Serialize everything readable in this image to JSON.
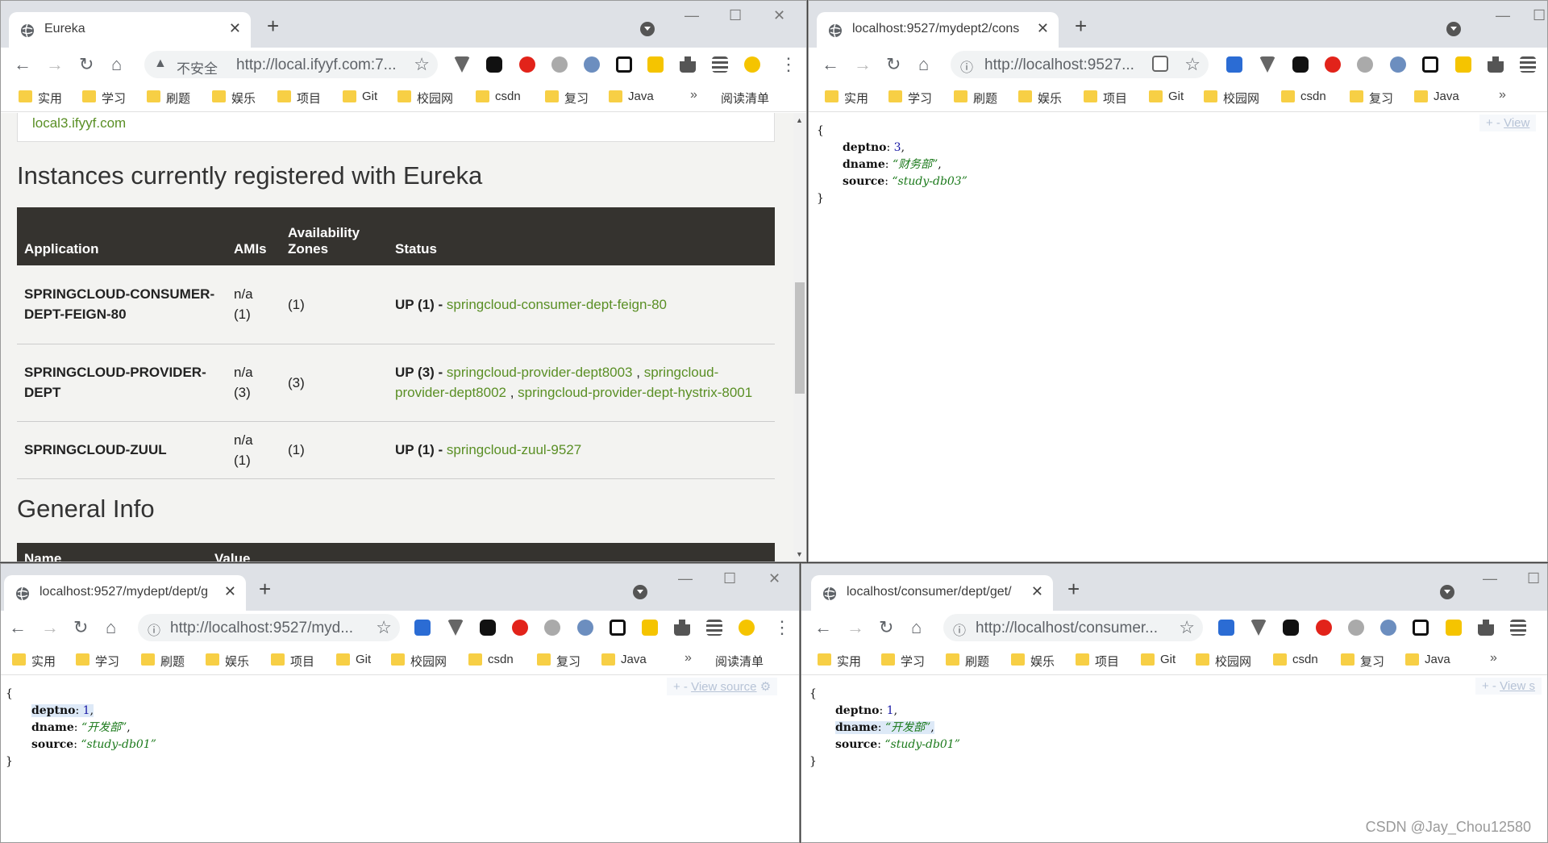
{
  "bookmarks": [
    "实用",
    "学习",
    "刷题",
    "娱乐",
    "项目",
    "Git",
    "校园网",
    "csdn",
    "复习",
    "Java"
  ],
  "bookmarks_more": "»",
  "reading_list": "阅读清单",
  "icons": {
    "back": "←",
    "forward": "→",
    "reload": "↻",
    "home": "⌂",
    "star": "☆",
    "new_tab": "+",
    "tab_close": "✕",
    "minimize": "—",
    "maximize": "☐",
    "close": "✕"
  },
  "windows": {
    "w1": {
      "tab_title": "Eureka",
      "insecure_label": "不安全",
      "url": "http://local.ifyyf.com:7...",
      "prev_link": "local3.ifyyf.com",
      "instances_heading": "Instances currently registered with Eureka",
      "table": {
        "headers": [
          "Application",
          "AMIs",
          "Availability Zones",
          "Status"
        ],
        "rows": [
          {
            "app": "SPRINGCLOUD-CONSUMER-DEPT-FEIGN-80",
            "amis": "n/a (1)",
            "zones": "(1)",
            "status": "UP (1) - ",
            "links": [
              "springcloud-consumer-dept-feign-80"
            ]
          },
          {
            "app": "SPRINGCLOUD-PROVIDER-DEPT",
            "amis": "n/a (3)",
            "zones": "(3)",
            "status": "UP (3) - ",
            "links": [
              "springcloud-provider-dept8003",
              "springcloud-provider-dept8002",
              "springcloud-provider-dept-hystrix-8001"
            ]
          },
          {
            "app": "SPRINGCLOUD-ZUUL",
            "amis": "n/a (1)",
            "zones": "(1)",
            "status": "UP (1) - ",
            "links": [
              "springcloud-zuul-9527"
            ]
          }
        ]
      },
      "general_heading": "General Info",
      "general_headers": [
        "Name",
        "Value"
      ]
    },
    "w2": {
      "tab_title": "localhost:9527/mydept2/cons",
      "url": "http://localhost:9527...",
      "json": {
        "deptno": "3",
        "dname": "“财务部”",
        "source": "“study-db03”"
      },
      "view_source": "View"
    },
    "w3": {
      "tab_title": "localhost:9527/mydept/dept/g",
      "url": "http://localhost:9527/myd...",
      "json": {
        "deptno": "1",
        "dname": "“开发部”",
        "source": "“study-db01”"
      },
      "view_source": "View source"
    },
    "w4": {
      "tab_title": "localhost/consumer/dept/get/",
      "url": "http://localhost/consumer...",
      "json": {
        "deptno": "1",
        "dname": "“开发部”",
        "source": "“study-db01”"
      },
      "view_source": "View s"
    }
  },
  "watermark": "CSDN @Jay_Chou12580"
}
